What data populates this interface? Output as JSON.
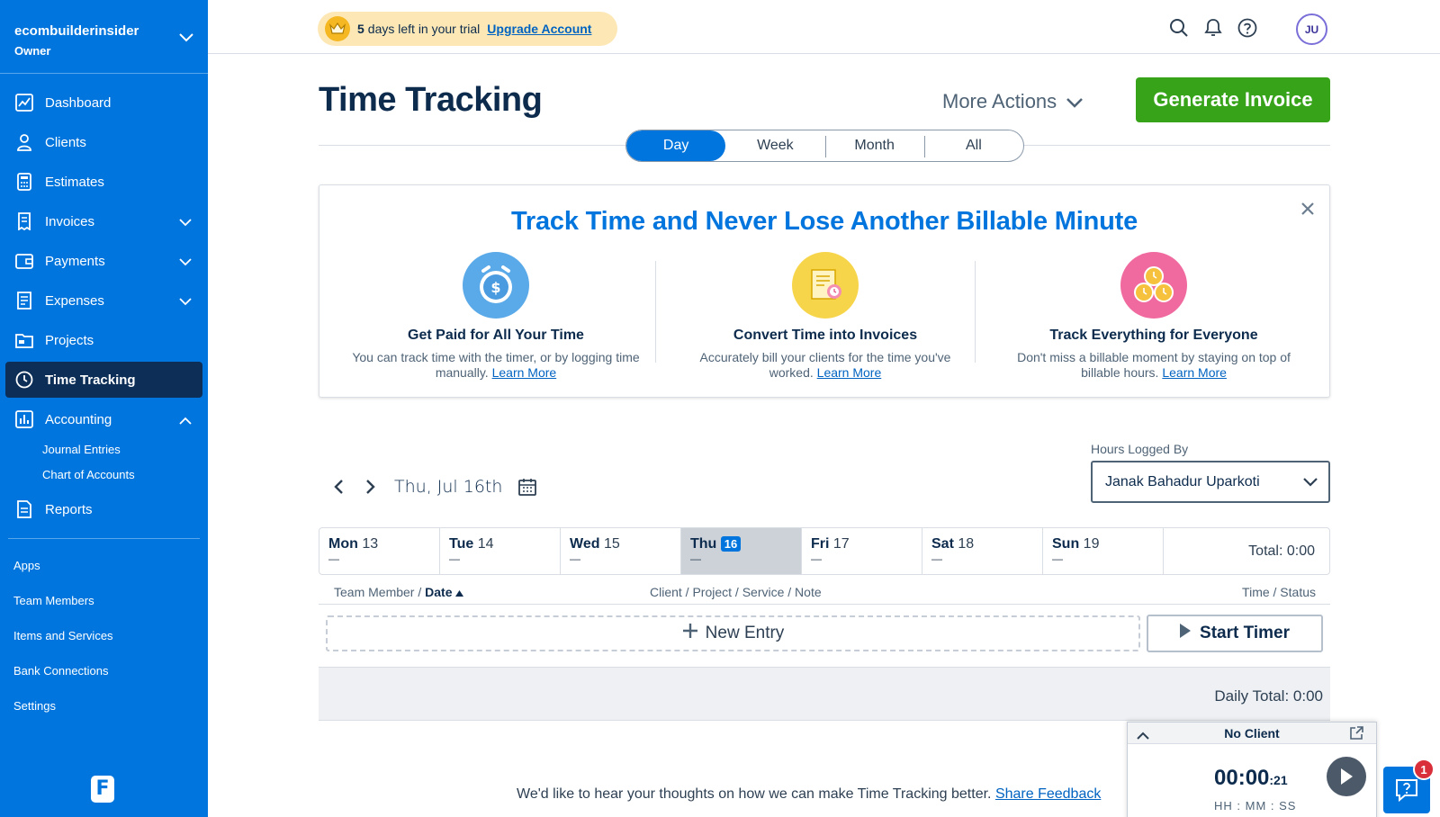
{
  "account": {
    "name": "ecombuilderinsider",
    "role": "Owner"
  },
  "sidebar": {
    "items": [
      {
        "label": "Dashboard"
      },
      {
        "label": "Clients"
      },
      {
        "label": "Estimates"
      },
      {
        "label": "Invoices"
      },
      {
        "label": "Payments"
      },
      {
        "label": "Expenses"
      },
      {
        "label": "Projects"
      },
      {
        "label": "Time Tracking"
      },
      {
        "label": "Accounting"
      }
    ],
    "accounting_sub": [
      "Journal Entries",
      "Chart of Accounts"
    ],
    "reports": "Reports",
    "lower": [
      "Apps",
      "Team Members",
      "Items and Services",
      "Bank Connections",
      "Settings"
    ],
    "logo_letter": "F"
  },
  "topbar": {
    "trial_days": "5",
    "trial_text": "days left in your trial",
    "upgrade": "Upgrade Account",
    "avatar": "JU"
  },
  "page": {
    "title": "Time Tracking",
    "more_actions": "More Actions",
    "generate_invoice": "Generate Invoice",
    "tabs": [
      "Day",
      "Week",
      "Month",
      "All"
    ],
    "active_tab": "Day"
  },
  "promo": {
    "title": "Track Time and Never Lose Another Billable Minute",
    "features": [
      {
        "title": "Get Paid for All Your Time",
        "text": "You can track time with the timer, or by logging time manually.",
        "link": "Learn More"
      },
      {
        "title": "Convert Time into Invoices",
        "text": "Accurately bill your clients for the time you've worked.",
        "link": "Learn More"
      },
      {
        "title": "Track Everything for Everyone",
        "text": "Don't miss a billable moment by staying on top of billable hours.",
        "link": "Learn More"
      }
    ]
  },
  "date_nav": {
    "current": "Thu, Jul 16th"
  },
  "hours_logged": {
    "label": "Hours Logged By",
    "value": "Janak Bahadur Uparkoti"
  },
  "week": {
    "days": [
      {
        "name": "Mon",
        "num": "13",
        "value": "—"
      },
      {
        "name": "Tue",
        "num": "14",
        "value": "—"
      },
      {
        "name": "Wed",
        "num": "15",
        "value": "—"
      },
      {
        "name": "Thu",
        "num": "16",
        "value": "—"
      },
      {
        "name": "Fri",
        "num": "17",
        "value": "—"
      },
      {
        "name": "Sat",
        "num": "18",
        "value": "—"
      },
      {
        "name": "Sun",
        "num": "19",
        "value": "—"
      }
    ],
    "total": "Total: 0:00"
  },
  "table": {
    "col1_prefix": "Team Member /",
    "col1_sort": "Date",
    "col2": "Client / Project / Service / Note",
    "col3": "Time / Status"
  },
  "actions": {
    "new_entry": "New Entry",
    "start_timer": "Start Timer"
  },
  "daily_total": "Daily Total: 0:00",
  "feedback": {
    "text": "We'd like to hear your thoughts on how we can make Time Tracking better.",
    "link": "Share Feedback"
  },
  "timer": {
    "client": "No Client",
    "time": "00:00",
    "seconds": ":21",
    "format": "HH : MM : SS"
  },
  "help": {
    "badge": "1"
  },
  "colors": {
    "sidebar": "#0075dd",
    "active_nav": "#0c2e57",
    "primary": "#0075dd",
    "success": "#36a318",
    "trial_bg": "#fde8b5"
  }
}
